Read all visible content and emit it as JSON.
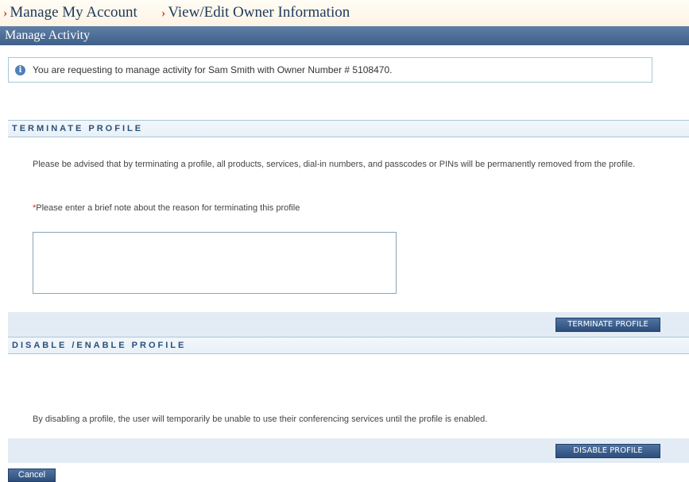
{
  "breadcrumb": {
    "items": [
      "Manage My Account",
      "View/Edit Owner Information"
    ]
  },
  "activity_bar": {
    "title": "Manage Activity"
  },
  "info": {
    "message": "You are requesting to manage activity for Sam Smith with Owner Number # 5108470."
  },
  "terminate": {
    "header": "TERMINATE PROFILE",
    "description": "Please be advised that by terminating a profile, all products, services, dial-in numbers, and passcodes or PINs will be permanently removed from the profile.",
    "required_marker": "*",
    "note_label": "Please enter a brief note about the reason for terminating this profile",
    "note_value": "",
    "button_label": "TERMINATE PROFILE"
  },
  "disable": {
    "header": "DISABLE /ENABLE PROFILE",
    "description": "By disabling a profile, the user will temporarily be unable to use their conferencing services until the profile is enabled.",
    "button_label": "DISABLE PROFILE"
  },
  "footer": {
    "cancel_label": "Cancel"
  },
  "colors": {
    "breadcrumb_chevron": "#d0492b",
    "breadcrumb_text": "#203a5c",
    "activity_bar": "#4a6c95",
    "section_header_text": "#2a4f7a",
    "button": "#3a5d8c",
    "required": "#d22a2a",
    "info_icon": "#4f7fb8"
  },
  "icons": {
    "breadcrumb_separator": "chevron-right-icon",
    "info": "info-icon"
  }
}
